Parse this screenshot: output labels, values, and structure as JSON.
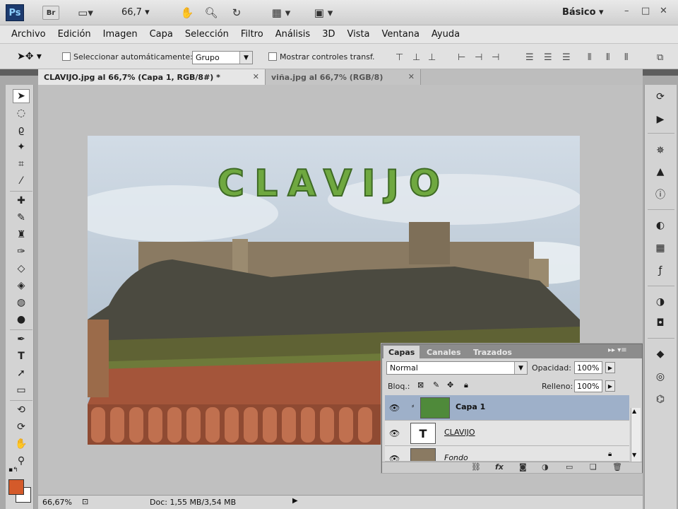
{
  "app": {
    "logo": "Ps",
    "bridge": "Br",
    "zoom": "66,7",
    "workspace": "Básico",
    "window_controls": [
      "–",
      "□",
      "✕"
    ]
  },
  "menu": [
    "Archivo",
    "Edición",
    "Imagen",
    "Capa",
    "Selección",
    "Filtro",
    "Análisis",
    "3D",
    "Vista",
    "Ventana",
    "Ayuda"
  ],
  "options": {
    "auto_select_label": "Seleccionar automáticamente:",
    "auto_select_value": "Grupo",
    "show_transform_label": "Mostrar controles transf."
  },
  "tabs": [
    {
      "label": "CLAVIJO.jpg al 66,7% (Capa 1, RGB/8#) *",
      "active": true
    },
    {
      "label": "viña.jpg al 66,7% (RGB/8)",
      "active": false
    }
  ],
  "canvas": {
    "text_layer": "CLAVIJO",
    "colors": {
      "sky": "#b7c7d6",
      "rock": "#4a4a40",
      "roof": "#a4553a",
      "grass": "#6e7a3a"
    }
  },
  "layers_panel": {
    "tabs": [
      "Capas",
      "Canales",
      "Trazados"
    ],
    "blend_mode": "Normal",
    "opacity_label": "Opacidad:",
    "opacity": "100%",
    "lock_label": "Bloq.:",
    "fill_label": "Relleno:",
    "fill": "100%",
    "layers": [
      {
        "name": "Capa 1",
        "selected": true
      },
      {
        "name": "CLAVIJO",
        "type": "text"
      },
      {
        "name": "Fondo"
      }
    ]
  },
  "status": {
    "zoom": "66,67%",
    "doc": "Doc: 1,55 MB/3,54 MB"
  },
  "icons": {
    "tools": [
      "move-icon",
      "marquee-icon",
      "lasso-icon",
      "magic-wand-icon",
      "crop-icon",
      "eyedropper-icon",
      "healing-icon",
      "brush-icon",
      "stamp-icon",
      "history-brush-icon",
      "eraser-icon",
      "paint-bucket-icon",
      "blur-icon",
      "dodge-icon",
      "pen-icon",
      "type-icon",
      "path-select-icon",
      "shape-icon",
      "3d-rotate-icon",
      "3d-orbit-icon",
      "hand-icon",
      "zoom-icon"
    ],
    "dock": [
      "history-icon",
      "actions-icon",
      "navigator-icon",
      "histogram-icon",
      "info-icon",
      "color-icon",
      "swatches-icon",
      "styles-icon",
      "adjustments-icon",
      "masks-icon",
      "layers-icon",
      "channels-icon",
      "paths-icon"
    ]
  }
}
